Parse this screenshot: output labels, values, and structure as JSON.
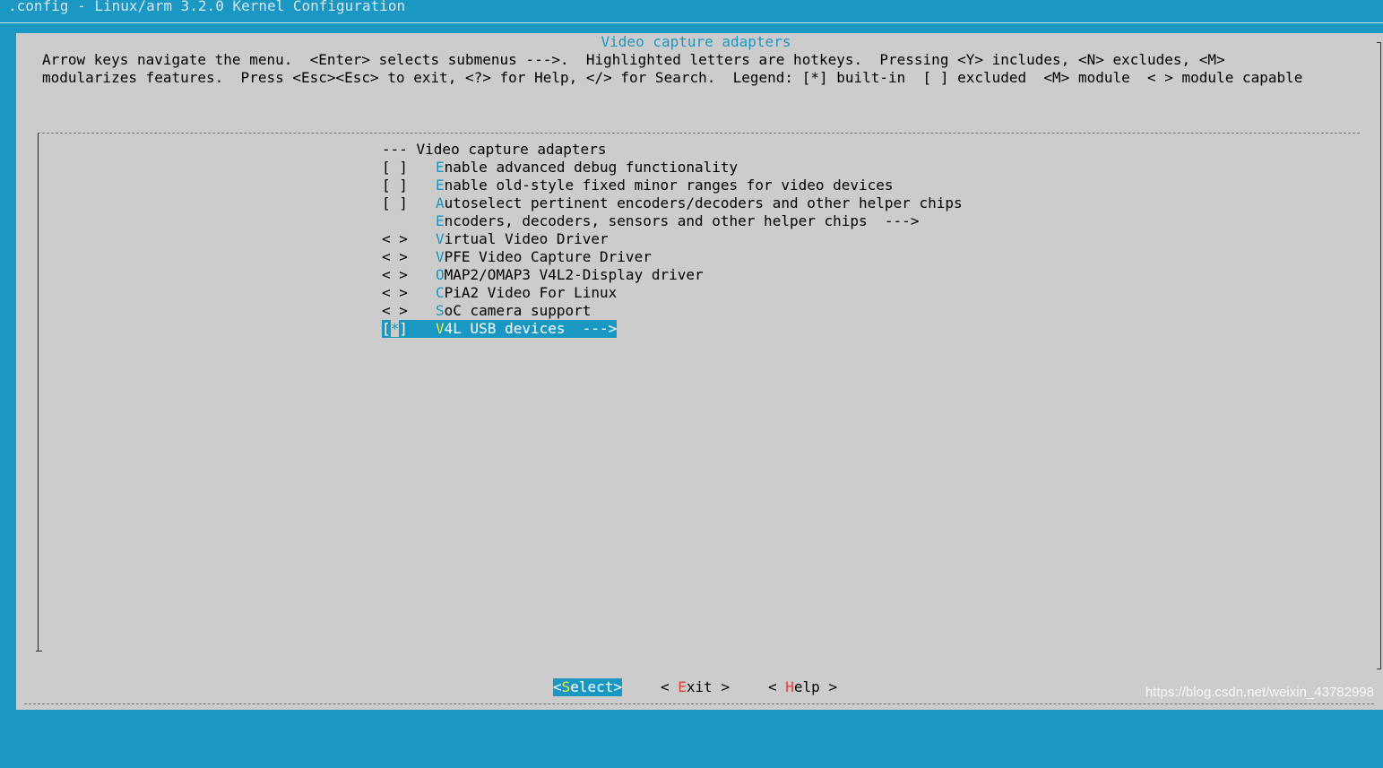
{
  "window": {
    "title": ".config - Linux/arm 3.2.0 Kernel Configuration"
  },
  "dialog": {
    "title": "Video capture adapters",
    "help_lines": [
      "Arrow keys navigate the menu.  <Enter> selects submenus --->.  Highlighted letters are hotkeys.  Pressing <Y> includes, <N> excludes, <M>",
      "modularizes features.  Press <Esc><Esc> to exit, <?> for Help, </> for Search.  Legend: [*] built-in  [ ] excluded  <M> module  < > module capable"
    ]
  },
  "menu": {
    "header": "--- Video capture adapters",
    "items": [
      {
        "mark": "[ ]",
        "hotkey": "E",
        "rest": "nable advanced debug functionality"
      },
      {
        "mark": "[ ]",
        "hotkey": "E",
        "rest": "nable old-style fixed minor ranges for video devices"
      },
      {
        "mark": "[ ]",
        "hotkey": "A",
        "rest": "utoselect pertinent encoders/decoders and other helper chips"
      },
      {
        "mark": "",
        "hotkey": "E",
        "rest": "ncoders, decoders, sensors and other helper chips  --->"
      },
      {
        "mark": "< >",
        "hotkey": "V",
        "rest": "irtual Video Driver"
      },
      {
        "mark": "< >",
        "hotkey": "V",
        "rest": "PFE Video Capture Driver"
      },
      {
        "mark": "< >",
        "hotkey": "O",
        "rest": "MAP2/OMAP3 V4L2-Display driver"
      },
      {
        "mark": "< >",
        "hotkey": "C",
        "rest": "PiA2 Video For Linux"
      },
      {
        "mark": "< >",
        "hotkey": "S",
        "rest": "oC camera support"
      }
    ],
    "selected": {
      "mark_open": "[",
      "mark_cursor": "*",
      "mark_close": "]",
      "hotkey": "V",
      "rest": "4L USB devices  --->"
    }
  },
  "buttons": {
    "select": {
      "open": "<",
      "hotkey": "S",
      "rest": "elect",
      "close": ">"
    },
    "exit": {
      "open": "< ",
      "hotkey": "E",
      "rest": "xit",
      "close": " >"
    },
    "help": {
      "open": "< ",
      "hotkey": "H",
      "rest": "elp",
      "close": " >"
    }
  },
  "watermark": "https://blog.csdn.net/weixin_43782998",
  "colors": {
    "terminal_bg": "#1a97c3",
    "dialog_bg": "#cccccc",
    "hotkey": "#1a97c3",
    "selected_hotkey": "#f1ea38",
    "button_hotkey": "#e04040"
  }
}
